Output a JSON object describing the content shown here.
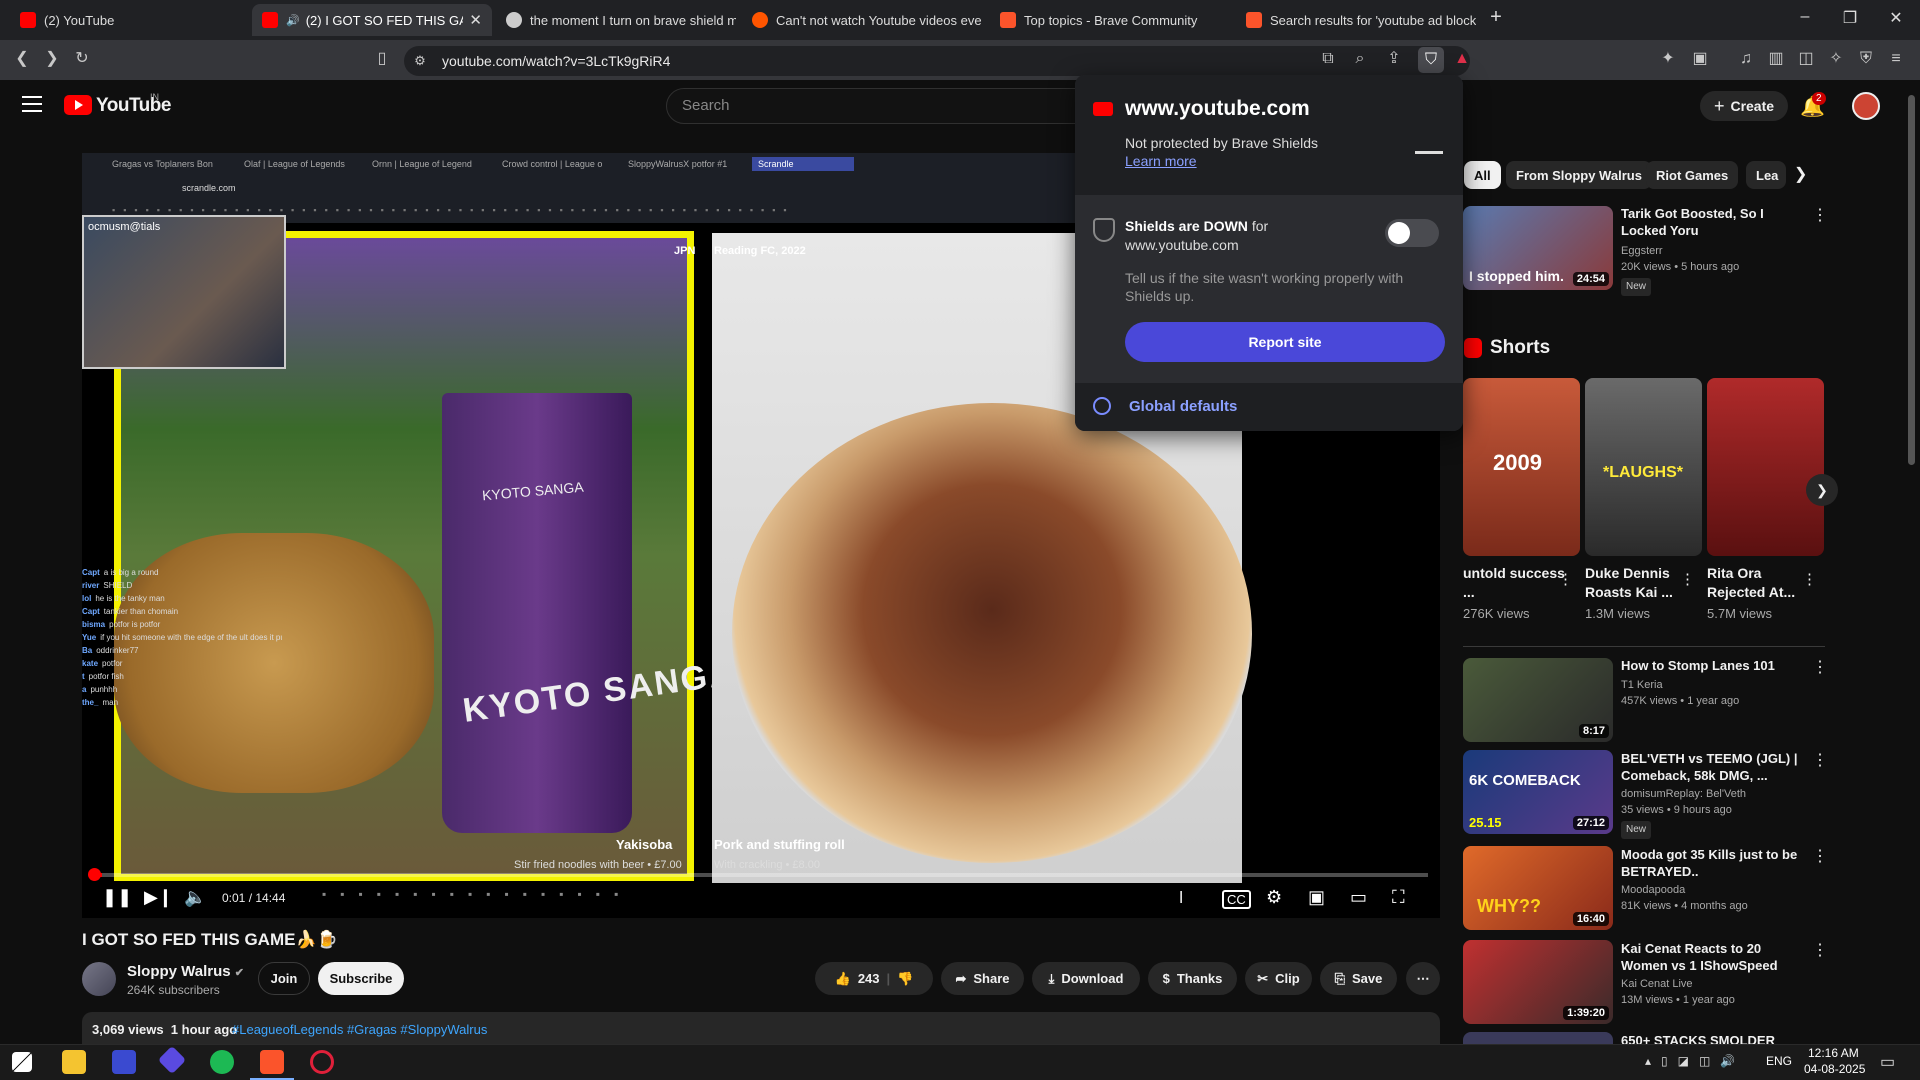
{
  "browser": {
    "tabs": [
      {
        "label": "(2) YouTube",
        "color": "#ff0000"
      },
      {
        "label": "(2) I GOT SO FED THIS GAME",
        "color": "#ff0000",
        "active": true
      },
      {
        "label": "the moment I turn on brave shield m",
        "color": "#cccccc"
      },
      {
        "label": "Can't not watch Youtube videos even",
        "color": "#ff5500"
      },
      {
        "label": "Top topics - Brave Community",
        "color": "#fb542b"
      },
      {
        "label": "Search results for 'youtube ad block'",
        "color": "#fb542b"
      }
    ],
    "new_tab": "+",
    "url": "youtube.com/watch?v=3LcTk9gRiR4"
  },
  "yt_header": {
    "logo": "YouTube",
    "country": "IN",
    "search_placeholder": "Search",
    "create_label": "Create",
    "notifications": "2"
  },
  "video": {
    "inner_tabs": [
      "Gragas vs Toplaners Bon",
      "Olaf | League of Legends",
      "Ornn | League of Legend",
      "Crowd control | League o",
      "SloppyWalrusX potfor #1",
      "Scrandle"
    ],
    "inner_url": "scrandle.com",
    "cam_label": "ocmusm@tials",
    "left_tag": "JPN",
    "left_title": "Yakisoba",
    "left_sub": "Stir fried noodles with beer • £7.00",
    "right_tag": "Reading FC, 2022",
    "right_title": "Pork and stuffing roll",
    "right_sub": "With crackling • £8.00",
    "cup_line1": "KYOTO SANGA",
    "cup_line2": "KYOTO SANGA",
    "chat": [
      {
        "user": "Capt",
        "msg": "a is big a round"
      },
      {
        "user": "river",
        "msg": "SHIELD"
      },
      {
        "user": "lol",
        "msg": "he is the tanky man"
      },
      {
        "user": "Capt",
        "msg": "tankier than chomain"
      },
      {
        "user": "bisma",
        "msg": "potfor is potfor"
      },
      {
        "user": "Yue",
        "msg": "if you hit someone with the edge of the ult does it push them?"
      },
      {
        "user": "Ba",
        "msg": "oddrinker77"
      },
      {
        "user": "kate",
        "msg": "potfor"
      },
      {
        "user": "t",
        "msg": "potfor fish"
      },
      {
        "user": "a",
        "msg": "punhhh"
      },
      {
        "user": "the_",
        "msg": "man"
      }
    ],
    "time_current": "0:01",
    "time_total": "14:44",
    "progress": 0.001
  },
  "below_video": {
    "title": "I GOT SO FED THIS GAME🍌🍺",
    "channel": "Sloppy Walrus",
    "subscribers": "264K subscribers",
    "join": "Join",
    "subscribe": "Subscribe",
    "likes": "243",
    "share": "Share",
    "download": "Download",
    "thanks": "Thanks",
    "clip": "Clip",
    "save": "Save",
    "views": "3,069 views",
    "age": "1 hour ago",
    "tags": "#LeagueofLegends #Gragas #SloppyWalrus"
  },
  "chips": [
    "All",
    "From Sloppy Walrus",
    "Riot Games",
    "Lea"
  ],
  "recommendations": [
    {
      "title": "Tarik Got Boosted, So I Locked Yoru",
      "channel": "Eggsterr",
      "meta": "20K views • 5 hours ago",
      "badge": "New",
      "duration": "24:54",
      "thumb_text": "I stopped him.",
      "color": "#8a3a3a"
    },
    {
      "title": "How to Stomp Lanes 101",
      "channel": "T1 Keria",
      "meta": "457K views • 1 year ago",
      "badge": "",
      "duration": "8:17",
      "thumb_text": "",
      "color": "#3a4a3a"
    },
    {
      "title": "BEL'VETH vs TEEMO (JGL) | Comeback, 58k DMG, ...",
      "channel": "domisumReplay: Bel'Veth",
      "meta": "35 views • 9 hours ago",
      "badge": "New",
      "duration": "27:12",
      "thumb_text": "6K COMEBACK",
      "color": "#2a4a7a"
    },
    {
      "title": "Mooda got 35 Kills just to be BETRAYED..",
      "channel": "Moodapooda",
      "meta": "81K views • 4 months ago",
      "badge": "",
      "duration": "16:40",
      "thumb_text": "WHY??",
      "color": "#c2542a"
    },
    {
      "title": "Kai Cenat Reacts to 20 Women vs 1 IShowSpeed",
      "channel": "Kai Cenat Live",
      "meta": "13M views • 1 year ago",
      "badge": "",
      "duration": "1:39:20",
      "thumb_text": "",
      "color": "#a03030"
    },
    {
      "title": "650+ STACKS SMOLDER",
      "channel": "",
      "meta": "",
      "badge": "",
      "duration": "",
      "thumb_text": "",
      "color": "#3a3a5a"
    }
  ],
  "shorts": {
    "heading": "Shorts",
    "items": [
      {
        "title": "untold success ...",
        "views": "276K views",
        "thumb_text": "2009",
        "color": "#a83a2a"
      },
      {
        "title": "Duke Dennis Roasts Kai ...",
        "views": "1.3M views",
        "thumb_text": "*LAUGHS*",
        "color": "#5a5a5a"
      },
      {
        "title": "Rita Ora Rejected At...",
        "views": "5.7M views",
        "thumb_text": "",
        "color": "#8a1a1a"
      }
    ]
  },
  "shields": {
    "domain": "www.youtube.com",
    "status": "Not protected by Brave Shields",
    "learn_more": "Learn more",
    "down_bold": "Shields are DOWN",
    "down_rest": "for www.youtube.com",
    "note": "Tell us if the site wasn't working properly with Shields up.",
    "report": "Report site",
    "global": "Global defaults"
  },
  "taskbar": {
    "time": "12:16 AM",
    "date": "04-08-2025",
    "lang": "ENG"
  }
}
